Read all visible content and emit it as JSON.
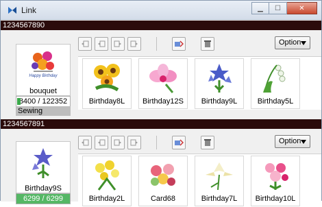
{
  "window": {
    "title": "Link"
  },
  "colors": {
    "section_bar": "#2b0b0b",
    "progress": "#3aa94a",
    "sewing_bg": "#bdbdbd"
  },
  "groups": [
    {
      "id": "1234567890",
      "left": {
        "name": "bouquet",
        "stitches": "8400 / 122352",
        "status": "Sewing",
        "progress": 0.0687
      },
      "option_label": "Option",
      "tiles": [
        "Birthday8L",
        "Birthday12S",
        "Birthday9L",
        "Birthday5L"
      ]
    },
    {
      "id": "1234567891",
      "left": {
        "name": "Birthday9S",
        "stitches": "6299 / 6299",
        "progress": 1.0
      },
      "option_label": "Option",
      "tiles": [
        "Birthday2L",
        "Card68",
        "Birthday7L",
        "Birthday10L"
      ]
    }
  ],
  "icons": {
    "toolbar": [
      "move-left-icon",
      "move-left-one-icon",
      "move-right-one-icon",
      "move-right-icon",
      "send-icon",
      "delete-icon"
    ],
    "tiles": [
      "sunflowers-icon",
      "orchid-icon",
      "blue-flowers-icon",
      "lily-of-valley-icon",
      "yellow-bouquet-icon",
      "rose-bouquet-icon",
      "lily-icon",
      "pink-bouquet-icon"
    ]
  }
}
